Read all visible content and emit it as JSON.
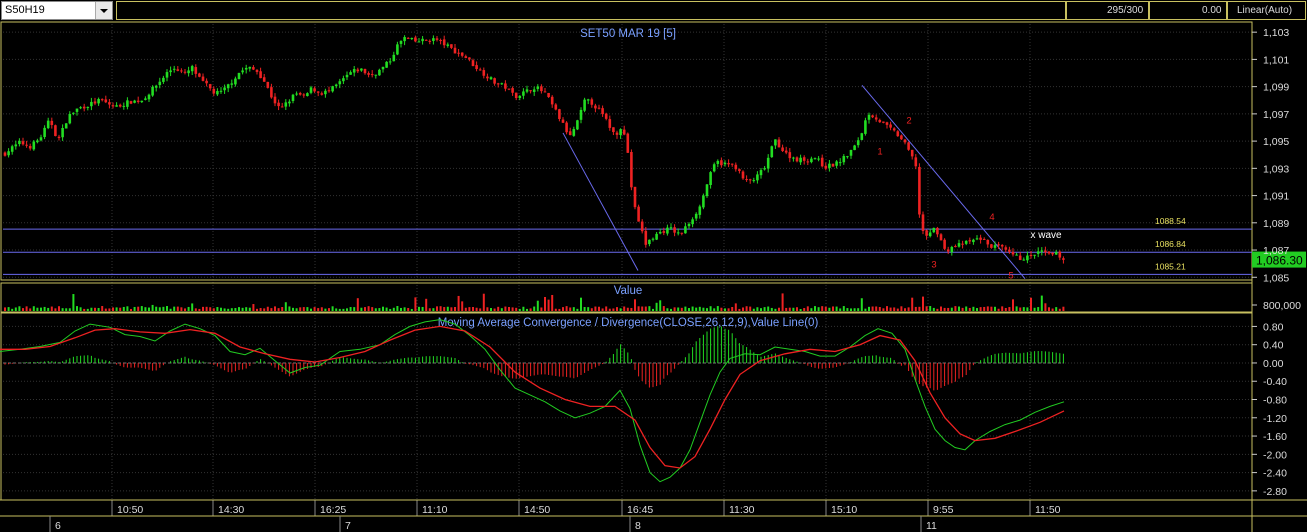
{
  "toolbar": {
    "symbol": "S50H19",
    "bars": "295/300",
    "offset": "0.00",
    "scale": "Linear(Auto)"
  },
  "chart_data": [
    {
      "type": "candlestick",
      "title": "SET50 MAR 19   [5]",
      "y_ticks": [
        "1,103",
        "1,101",
        "1,099",
        "1,097",
        "1,095",
        "1,093",
        "1,091",
        "1,089",
        "1,087",
        "1,085"
      ],
      "last_price": "1,086.30",
      "ylim": [
        1084.8,
        1103.6
      ],
      "close_path": [
        [
          0,
          1093.8
        ],
        [
          10,
          1094.4
        ],
        [
          20,
          1094.9
        ],
        [
          30,
          1094.6
        ],
        [
          40,
          1095.2
        ],
        [
          50,
          1096.6
        ],
        [
          58,
          1095.0
        ],
        [
          68,
          1096.8
        ],
        [
          78,
          1097.4
        ],
        [
          90,
          1097.7
        ],
        [
          100,
          1098.0
        ],
        [
          115,
          1097.5
        ],
        [
          130,
          1097.9
        ],
        [
          142,
          1098.0
        ],
        [
          150,
          1098.6
        ],
        [
          160,
          1099.4
        ],
        [
          168,
          1100.1
        ],
        [
          175,
          1100.4
        ],
        [
          185,
          1099.9
        ],
        [
          192,
          1100.4
        ],
        [
          200,
          1099.5
        ],
        [
          208,
          1099.0
        ],
        [
          215,
          1098.5
        ],
        [
          222,
          1098.6
        ],
        [
          232,
          1099.4
        ],
        [
          240,
          1100.1
        ],
        [
          248,
          1100.4
        ],
        [
          258,
          1100.1
        ],
        [
          265,
          1099.3
        ],
        [
          272,
          1098.2
        ],
        [
          280,
          1097.3
        ],
        [
          288,
          1097.9
        ],
        [
          296,
          1098.5
        ],
        [
          304,
          1098.2
        ],
        [
          312,
          1098.9
        ],
        [
          320,
          1098.5
        ],
        [
          330,
          1098.7
        ],
        [
          340,
          1099.3
        ],
        [
          350,
          1100.0
        ],
        [
          360,
          1100.3
        ],
        [
          370,
          1099.8
        ],
        [
          380,
          1100.2
        ],
        [
          390,
          1100.9
        ],
        [
          398,
          1102.1
        ],
        [
          405,
          1102.6
        ],
        [
          415,
          1102.3
        ],
        [
          425,
          1102.4
        ],
        [
          435,
          1102.5
        ],
        [
          445,
          1102.1
        ],
        [
          455,
          1101.6
        ],
        [
          465,
          1101.2
        ],
        [
          475,
          1100.5
        ],
        [
          485,
          1099.9
        ],
        [
          495,
          1099.3
        ],
        [
          505,
          1099.0
        ],
        [
          515,
          1098.3
        ],
        [
          525,
          1098.6
        ],
        [
          535,
          1099.0
        ],
        [
          545,
          1098.5
        ],
        [
          555,
          1097.3
        ],
        [
          563,
          1096.2
        ],
        [
          570,
          1095.3
        ],
        [
          578,
          1096.5
        ],
        [
          585,
          1098.0
        ],
        [
          592,
          1097.8
        ],
        [
          600,
          1097.2
        ],
        [
          608,
          1096.3
        ],
        [
          615,
          1095.4
        ],
        [
          622,
          1096.2
        ],
        [
          628,
          1094.1
        ],
        [
          633,
          1090.5
        ],
        [
          640,
          1088.8
        ],
        [
          646,
          1087.4
        ],
        [
          652,
          1087.9
        ],
        [
          660,
          1088.3
        ],
        [
          670,
          1088.6
        ],
        [
          680,
          1088.1
        ],
        [
          690,
          1089.1
        ],
        [
          700,
          1090.2
        ],
        [
          708,
          1092.1
        ],
        [
          716,
          1093.5
        ],
        [
          725,
          1093.3
        ],
        [
          735,
          1093.2
        ],
        [
          745,
          1092.0
        ],
        [
          755,
          1092.2
        ],
        [
          765,
          1093.1
        ],
        [
          775,
          1095.1
        ],
        [
          785,
          1094.1
        ],
        [
          795,
          1093.7
        ],
        [
          805,
          1093.6
        ],
        [
          815,
          1093.8
        ],
        [
          825,
          1093.1
        ],
        [
          835,
          1093.3
        ],
        [
          845,
          1093.8
        ],
        [
          855,
          1094.6
        ],
        [
          862,
          1095.7
        ],
        [
          868,
          1097.1
        ],
        [
          876,
          1096.7
        ],
        [
          884,
          1096.2
        ],
        [
          892,
          1095.8
        ],
        [
          900,
          1095.3
        ],
        [
          908,
          1094.4
        ],
        [
          916,
          1093.2
        ],
        [
          920,
          1089.0
        ],
        [
          926,
          1087.8
        ],
        [
          932,
          1088.6
        ],
        [
          938,
          1088.3
        ],
        [
          945,
          1086.9
        ],
        [
          952,
          1087.2
        ],
        [
          960,
          1087.4
        ],
        [
          970,
          1087.6
        ],
        [
          980,
          1087.9
        ],
        [
          990,
          1087.3
        ],
        [
          1000,
          1087.2
        ],
        [
          1010,
          1086.7
        ],
        [
          1020,
          1086.4
        ],
        [
          1030,
          1086.5
        ],
        [
          1040,
          1086.9
        ],
        [
          1050,
          1086.6
        ],
        [
          1058,
          1086.7
        ],
        [
          1064,
          1086.3
        ]
      ],
      "horizontal_lines": [
        {
          "label": "1088.54",
          "value": 1088.54
        },
        {
          "label": "1086.84",
          "value": 1086.84
        },
        {
          "label": "1085.21",
          "value": 1085.21
        }
      ],
      "trend_lines": [
        {
          "from": [
            563,
            1095.6
          ],
          "to": [
            638,
            1085.5
          ]
        },
        {
          "from": [
            862,
            1099.1
          ],
          "to": [
            1025,
            1084.9
          ]
        }
      ],
      "annotations": [
        {
          "text": "1",
          "x": 880,
          "y": 1094.0
        },
        {
          "text": "2",
          "x": 909,
          "y": 1096.3
        },
        {
          "text": "3",
          "x": 934,
          "y": 1085.7
        },
        {
          "text": "4",
          "x": 992,
          "y": 1089.2
        },
        {
          "text": "5",
          "x": 1011,
          "y": 1084.9
        },
        {
          "text": "x wave",
          "x": 1046,
          "y": 1087.9
        }
      ]
    },
    {
      "type": "bar",
      "title": "Value",
      "y_ticks": [
        "800,000"
      ]
    },
    {
      "type": "line",
      "title": "Moving Average Convergence / Divergence(CLOSE,26,12,9),Value Line(0)",
      "y_ticks": [
        "0.80",
        "0.40",
        "0.00",
        "-0.40",
        "-0.80",
        "-1.20",
        "-1.60",
        "-2.00",
        "-2.40",
        "-2.80"
      ],
      "ylim": [
        -3.0,
        1.05
      ],
      "macd": [
        [
          0,
          0.25
        ],
        [
          20,
          0.3
        ],
        [
          40,
          0.36
        ],
        [
          60,
          0.45
        ],
        [
          75,
          0.7
        ],
        [
          90,
          0.85
        ],
        [
          110,
          0.78
        ],
        [
          125,
          0.62
        ],
        [
          140,
          0.58
        ],
        [
          155,
          0.48
        ],
        [
          170,
          0.7
        ],
        [
          185,
          0.85
        ],
        [
          200,
          0.75
        ],
        [
          215,
          0.6
        ],
        [
          230,
          0.25
        ],
        [
          245,
          0.18
        ],
        [
          260,
          0.32
        ],
        [
          275,
          0.05
        ],
        [
          290,
          -0.22
        ],
        [
          305,
          -0.1
        ],
        [
          320,
          -0.05
        ],
        [
          340,
          0.25
        ],
        [
          360,
          0.3
        ],
        [
          380,
          0.4
        ],
        [
          395,
          0.62
        ],
        [
          410,
          0.8
        ],
        [
          425,
          0.9
        ],
        [
          440,
          0.95
        ],
        [
          455,
          0.85
        ],
        [
          470,
          0.6
        ],
        [
          485,
          0.3
        ],
        [
          500,
          -0.15
        ],
        [
          515,
          -0.55
        ],
        [
          530,
          -0.7
        ],
        [
          545,
          -0.85
        ],
        [
          560,
          -1.05
        ],
        [
          575,
          -1.2
        ],
        [
          590,
          -1.1
        ],
        [
          605,
          -0.95
        ],
        [
          620,
          -0.6
        ],
        [
          630,
          -1.0
        ],
        [
          640,
          -1.8
        ],
        [
          650,
          -2.4
        ],
        [
          660,
          -2.6
        ],
        [
          670,
          -2.5
        ],
        [
          680,
          -2.3
        ],
        [
          690,
          -1.9
        ],
        [
          700,
          -1.3
        ],
        [
          710,
          -0.7
        ],
        [
          720,
          -0.2
        ],
        [
          730,
          0.1
        ],
        [
          745,
          0.2
        ],
        [
          760,
          0.18
        ],
        [
          775,
          0.35
        ],
        [
          790,
          0.3
        ],
        [
          805,
          0.25
        ],
        [
          820,
          0.15
        ],
        [
          835,
          0.15
        ],
        [
          850,
          0.35
        ],
        [
          865,
          0.6
        ],
        [
          878,
          0.75
        ],
        [
          892,
          0.65
        ],
        [
          905,
          0.3
        ],
        [
          915,
          -0.35
        ],
        [
          925,
          -0.95
        ],
        [
          935,
          -1.45
        ],
        [
          945,
          -1.7
        ],
        [
          955,
          -1.85
        ],
        [
          965,
          -1.9
        ],
        [
          975,
          -1.7
        ],
        [
          990,
          -1.5
        ],
        [
          1005,
          -1.35
        ],
        [
          1020,
          -1.25
        ],
        [
          1035,
          -1.08
        ],
        [
          1050,
          -0.95
        ],
        [
          1064,
          -0.85
        ]
      ],
      "signal": [
        [
          0,
          0.3
        ],
        [
          25,
          0.3
        ],
        [
          50,
          0.36
        ],
        [
          75,
          0.55
        ],
        [
          95,
          0.72
        ],
        [
          115,
          0.75
        ],
        [
          140,
          0.68
        ],
        [
          165,
          0.65
        ],
        [
          190,
          0.73
        ],
        [
          215,
          0.65
        ],
        [
          240,
          0.35
        ],
        [
          265,
          0.2
        ],
        [
          290,
          0.08
        ],
        [
          315,
          0.02
        ],
        [
          340,
          0.12
        ],
        [
          365,
          0.25
        ],
        [
          390,
          0.5
        ],
        [
          415,
          0.72
        ],
        [
          440,
          0.8
        ],
        [
          465,
          0.7
        ],
        [
          490,
          0.35
        ],
        [
          515,
          -0.2
        ],
        [
          540,
          -0.55
        ],
        [
          565,
          -0.8
        ],
        [
          590,
          -0.95
        ],
        [
          615,
          -0.95
        ],
        [
          635,
          -1.25
        ],
        [
          650,
          -1.85
        ],
        [
          665,
          -2.25
        ],
        [
          680,
          -2.3
        ],
        [
          695,
          -2.05
        ],
        [
          710,
          -1.45
        ],
        [
          725,
          -0.8
        ],
        [
          740,
          -0.25
        ],
        [
          760,
          0.05
        ],
        [
          785,
          0.2
        ],
        [
          810,
          0.3
        ],
        [
          835,
          0.25
        ],
        [
          860,
          0.4
        ],
        [
          880,
          0.6
        ],
        [
          900,
          0.5
        ],
        [
          915,
          0.05
        ],
        [
          930,
          -0.65
        ],
        [
          945,
          -1.2
        ],
        [
          960,
          -1.55
        ],
        [
          975,
          -1.7
        ],
        [
          995,
          -1.65
        ],
        [
          1015,
          -1.5
        ],
        [
          1040,
          -1.3
        ],
        [
          1064,
          -1.05
        ]
      ]
    }
  ],
  "x_axis": {
    "times": [
      {
        "label": "10:50",
        "x": 112
      },
      {
        "label": "14:30",
        "x": 213
      },
      {
        "label": "16:25",
        "x": 315
      },
      {
        "label": "11:10",
        "x": 417
      },
      {
        "label": "14:50",
        "x": 519
      },
      {
        "label": "16:45",
        "x": 622
      },
      {
        "label": "11:30",
        "x": 724
      },
      {
        "label": "15:10",
        "x": 826
      },
      {
        "label": "9:55",
        "x": 928
      },
      {
        "label": "11:50",
        "x": 1030
      }
    ],
    "dates": [
      {
        "label": "6",
        "x": 50
      },
      {
        "label": "7",
        "x": 340
      },
      {
        "label": "8",
        "x": 630
      },
      {
        "label": "11",
        "x": 921
      }
    ]
  },
  "colors": {
    "up": "#22dd22",
    "down": "#ee2222",
    "macd": "#22cc22",
    "signal": "#ee2222",
    "ref_line": "#6a6aee",
    "annotation": "#ee2222",
    "title": "#7aa0ff",
    "hline_label": "#e8e060"
  }
}
